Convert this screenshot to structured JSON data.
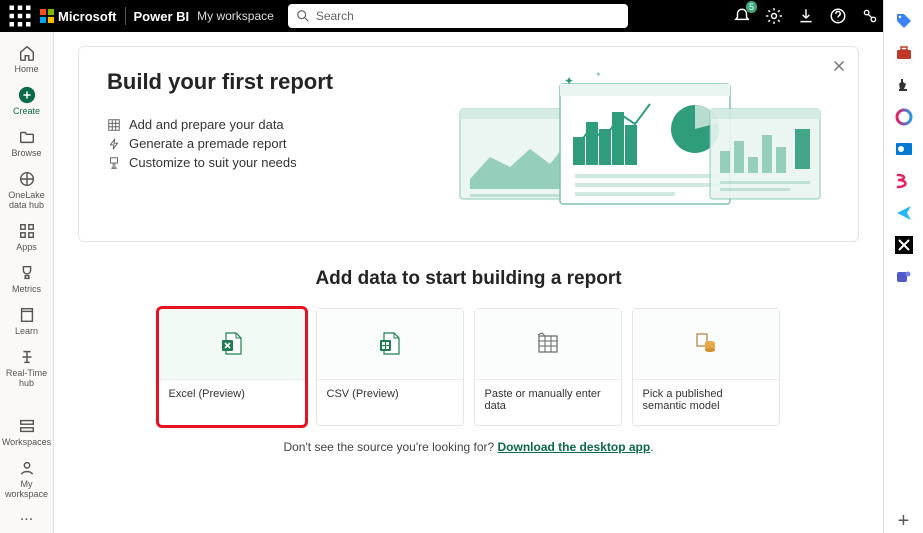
{
  "topbar": {
    "ms_label": "Microsoft",
    "brand": "Power BI",
    "workspace": "My workspace",
    "search_placeholder": "Search",
    "notification_count": "5"
  },
  "leftnav": {
    "items": [
      {
        "label": "Home"
      },
      {
        "label": "Create"
      },
      {
        "label": "Browse"
      },
      {
        "label": "OneLake data hub"
      },
      {
        "label": "Apps"
      },
      {
        "label": "Metrics"
      },
      {
        "label": "Learn"
      },
      {
        "label": "Real-Time hub"
      }
    ],
    "workspaces": "Workspaces",
    "my_workspace": "My workspace",
    "more": "..."
  },
  "hero": {
    "title": "Build your first report",
    "step1": "Add and prepare your data",
    "step2": "Generate a premade report",
    "step3": "Customize to suit your needs"
  },
  "section_title": "Add data to start building a report",
  "cards": [
    {
      "label": "Excel (Preview)"
    },
    {
      "label": "CSV (Preview)"
    },
    {
      "label": "Paste or manually enter data"
    },
    {
      "label": "Pick a published semantic model"
    }
  ],
  "footer": {
    "text": "Don't see the source you're looking for? ",
    "link": "Download the desktop app",
    "period": "."
  }
}
